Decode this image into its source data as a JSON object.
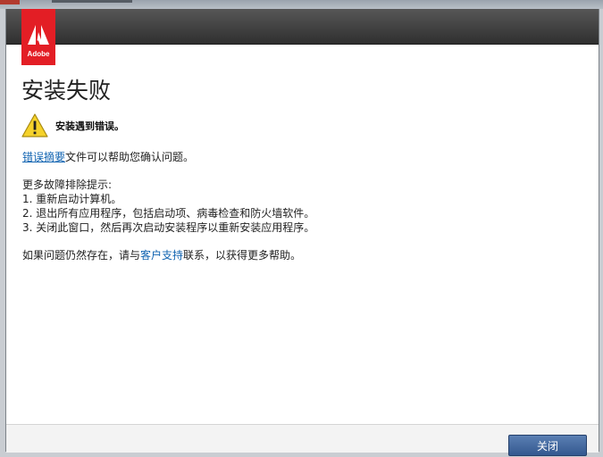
{
  "brand": {
    "logo_text": "Adobe",
    "color": "#e31e25"
  },
  "dialog": {
    "title": "安装失败",
    "warning": "安装遇到错误。",
    "summary": {
      "link": "错误摘要",
      "rest": "文件可以帮助您确认问题。"
    },
    "tips_heading": "更多故障排除提示:",
    "tips": [
      "1. 重新启动计算机。",
      "2. 退出所有应用程序，包括启动项、病毒检查和防火墙软件。",
      "3. 关闭此窗口，然后再次启动安装程序以重新安装应用程序。"
    ],
    "contact": {
      "before": "如果问题仍然存在，请与",
      "link": "客户支持",
      "after": "联系，以获得更多帮助。"
    }
  },
  "footer": {
    "close_label": "关闭"
  },
  "colors": {
    "link": "#1063b1",
    "button": "#34588f",
    "header": "#3a3a3a"
  }
}
